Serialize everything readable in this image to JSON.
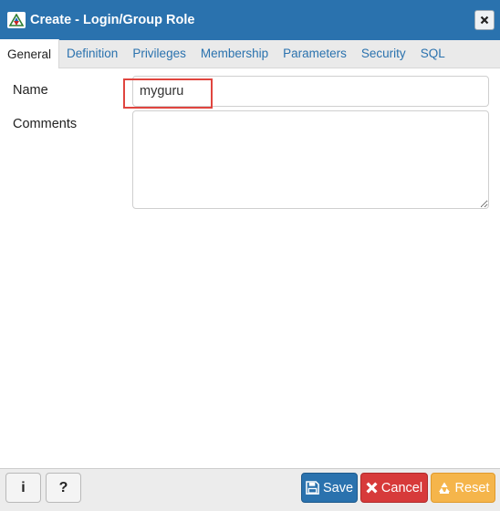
{
  "window": {
    "title": "Create - Login/Group Role",
    "logo_icon": "pgadmin-logo-icon",
    "close_icon": "close-icon"
  },
  "tabs": [
    {
      "label": "General",
      "active": true
    },
    {
      "label": "Definition",
      "active": false
    },
    {
      "label": "Privileges",
      "active": false
    },
    {
      "label": "Membership",
      "active": false
    },
    {
      "label": "Parameters",
      "active": false
    },
    {
      "label": "Security",
      "active": false
    },
    {
      "label": "SQL",
      "active": false
    }
  ],
  "form": {
    "name_label": "Name",
    "name_value": "myguru",
    "comments_label": "Comments",
    "comments_value": ""
  },
  "footer": {
    "info_label": "i",
    "help_label": "?",
    "save_label": "Save",
    "cancel_label": "Cancel",
    "reset_label": "Reset"
  },
  "colors": {
    "titlebar": "#2a72ae",
    "tab_link": "#2a72ae",
    "highlight": "#e0453f",
    "save": "#2a72ae",
    "cancel": "#d73a3a",
    "reset": "#f5b54b"
  }
}
